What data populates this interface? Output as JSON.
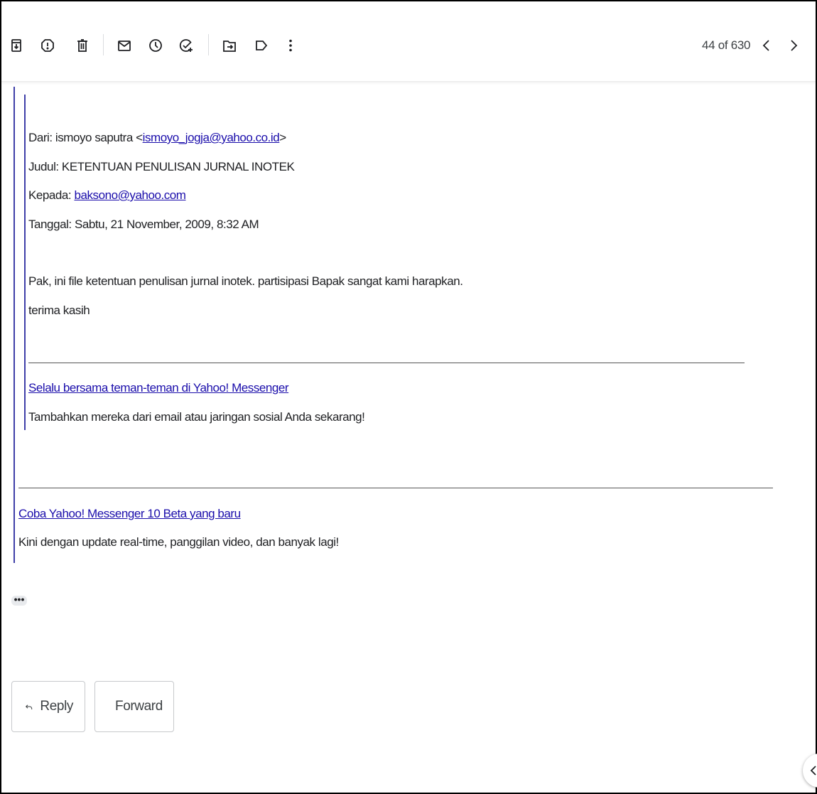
{
  "toolbar": {
    "icons": {
      "archive": "archive-icon",
      "spam": "report-spam-icon",
      "delete": "trash-icon",
      "mark_unread": "mail-icon",
      "snooze": "clock-icon",
      "add_task": "add-task-icon",
      "move": "move-to-icon",
      "label": "label-icon",
      "more": "more-vert-icon"
    },
    "pager_text": "44 of 630"
  },
  "message": {
    "from_prefix": "Dari: ismoyo saputra <",
    "from_email": "ismoyo_jogja@yahoo.co.id",
    "from_suffix": ">",
    "subject": "Judul: KETENTUAN PENULISAN JURNAL INOTEK",
    "to_prefix": "Kepada: ",
    "to_email": "baksono@yahoo.com",
    "date": "Tanggal: Sabtu, 21 November, 2009, 8:32 AM",
    "body_line1": "Pak, ini file ketentuan penulisan jurnal inotek. partisipasi Bapak sangat kami harapkan.",
    "body_line2": "terima kasih",
    "footer1_link": "Selalu bersama teman-teman di Yahoo! Messenger",
    "footer1_text": "Tambahkan mereka dari email atau jaringan sosial Anda sekarang!",
    "footer2_link": "Coba Yahoo! Messenger 10 Beta yang baru",
    "footer2_text": "Kini dengan update real-time, panggilan video, dan banyak lagi!"
  },
  "ellipsis_label": "•••",
  "actions": {
    "reply_label": "Reply",
    "forward_label": "Forward"
  },
  "colors": {
    "quote_border": "#3e3ea8",
    "link": "#1a0dab",
    "icon": "#202124"
  }
}
